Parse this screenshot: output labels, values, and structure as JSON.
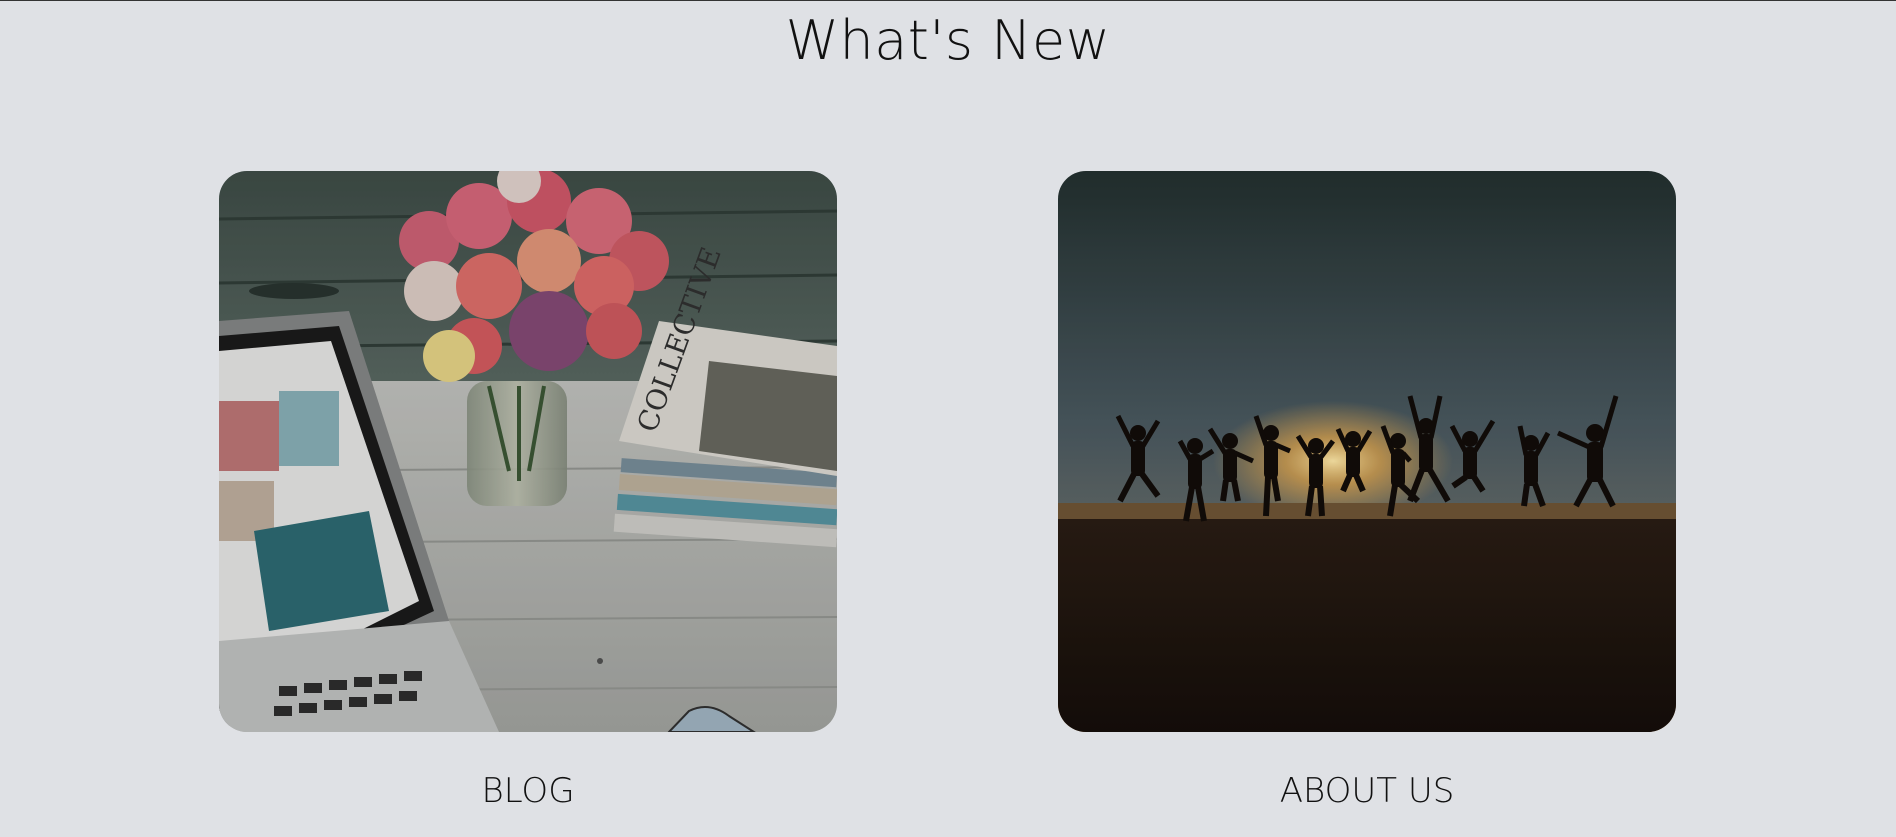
{
  "section": {
    "title": "What's New"
  },
  "cards": [
    {
      "label": "BLOG",
      "image_description": "desk-with-flowers-laptop-magazines"
    },
    {
      "label": "ABOUT US",
      "image_description": "people-jumping-at-sunset-silhouette"
    }
  ],
  "colors": {
    "background": "#dfe1e5",
    "text": "#111111"
  }
}
